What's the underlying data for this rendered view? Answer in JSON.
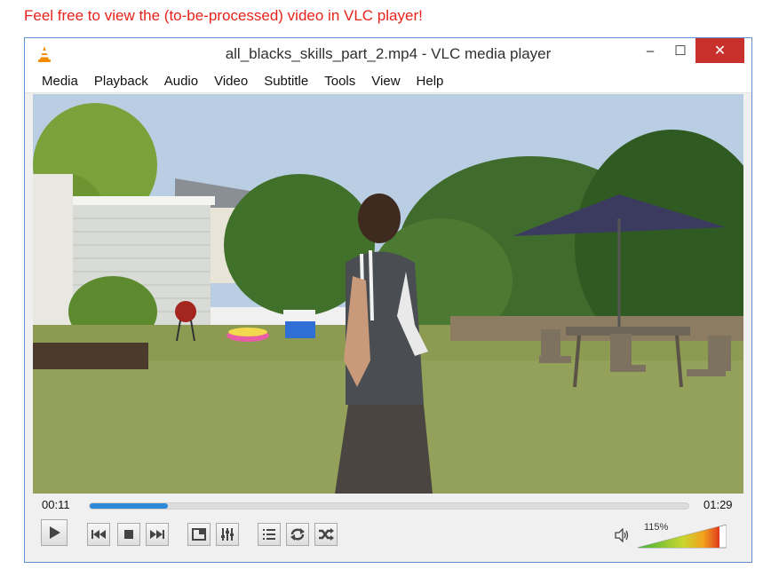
{
  "caption": "Feel free to view the (to-be-processed) video in VLC player!",
  "window": {
    "title": "all_blacks_skills_part_2.mp4 - VLC media player",
    "minimize": "–",
    "maximize": "☐",
    "close": "✕"
  },
  "menu": {
    "items": [
      "Media",
      "Playback",
      "Audio",
      "Video",
      "Subtitle",
      "Tools",
      "View",
      "Help"
    ]
  },
  "playback": {
    "current_time": "00:11",
    "total_time": "01:29",
    "progress": 0.13
  },
  "volume": {
    "label": "115%",
    "level": 1.15
  },
  "colors": {
    "caption": "#e8231b",
    "close_button": "#c7302b",
    "seek_fill": "#2e8ad8",
    "window_border": "#5f8fcf"
  }
}
